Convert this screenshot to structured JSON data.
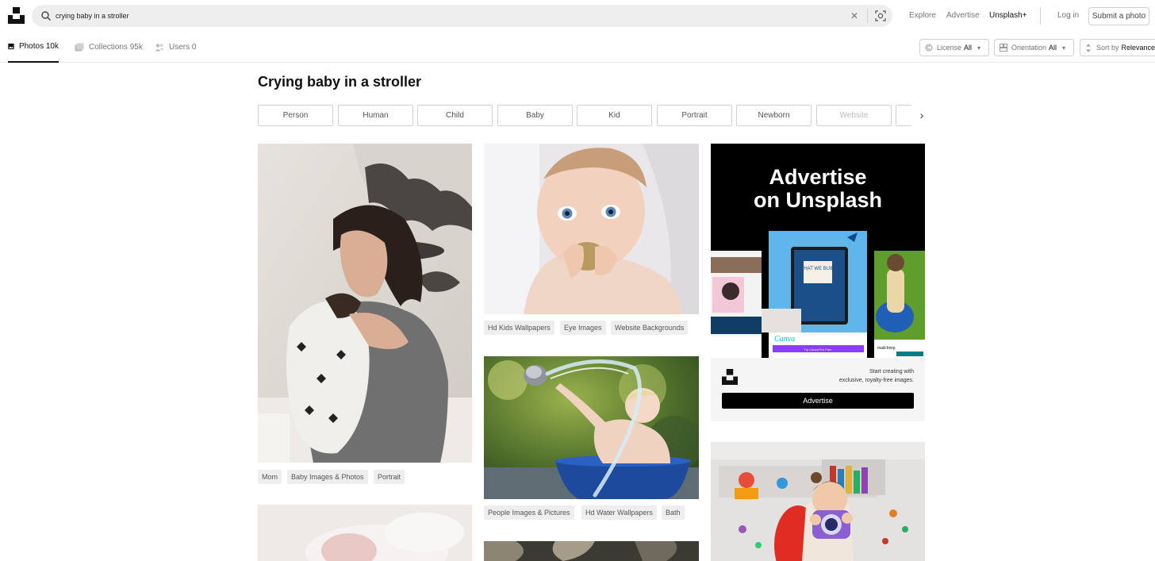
{
  "search": {
    "query": "crying baby in a stroller"
  },
  "nav": {
    "explore": "Explore",
    "advertise": "Advertise",
    "unsplash_plus": "Unsplash+",
    "login": "Log in",
    "submit": "Submit a photo"
  },
  "tabs": [
    {
      "label": "Photos",
      "count": "10k"
    },
    {
      "label": "Collections",
      "count": "95k"
    },
    {
      "label": "Users",
      "count": "0"
    }
  ],
  "filters": {
    "license": {
      "label": "License",
      "value": "All"
    },
    "orientation": {
      "label": "Orientation",
      "value": "All"
    },
    "sort": {
      "label": "Sort by",
      "value": "Relevance"
    }
  },
  "title": "Crying baby in a stroller",
  "related": [
    "Person",
    "Human",
    "Child",
    "Baby",
    "Kid",
    "Portrait",
    "Newborn",
    "Website"
  ],
  "photos": {
    "mom": {
      "tags": [
        "Mom",
        "Baby Images & Photos",
        "Portrait"
      ]
    },
    "baby": {
      "tags": [
        "Hd Kids Wallpapers",
        "Eye Images",
        "Website Backgrounds"
      ]
    },
    "bath": {
      "tags": [
        "People Images & Pictures",
        "Hd Water Wallpapers",
        "Bath"
      ]
    }
  },
  "ad": {
    "title_line1": "Advertise",
    "title_line2": "on Unsplash",
    "copy_line1": "Start creating with",
    "copy_line2": "exclusive, royalty-free images.",
    "button": "Advertise",
    "mock": {
      "canva": "Canva",
      "phone": "WHAT WE BUILT",
      "canva_cta": "Try Canva Pro Free",
      "mailchimp": "mailchimp"
    }
  },
  "colors": {
    "text": "#111111",
    "muted": "#767676",
    "border": "#d1d1d1",
    "chip_bg": "#eeeeee"
  },
  "icons": [
    "unsplash-logo-icon",
    "search-icon",
    "clear-icon",
    "visual-search-icon",
    "photo-icon",
    "collections-icon",
    "users-icon",
    "license-icon",
    "orientation-icon",
    "sort-icon",
    "chevron-down-icon",
    "chevron-right-icon"
  ]
}
